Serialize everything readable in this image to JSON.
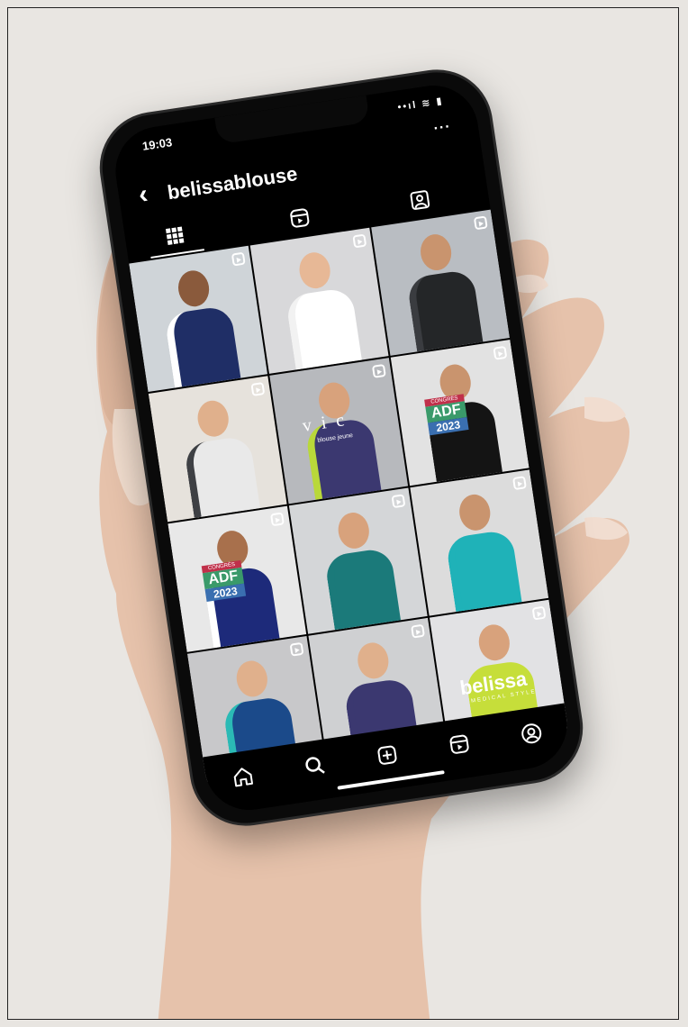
{
  "status": {
    "time": "19:03",
    "signal": "••ıl ≋ ▮"
  },
  "profile": {
    "username": "belissablouse",
    "more": "···"
  },
  "tabs": [
    {
      "name": "grid",
      "icon": "grid-icon",
      "active": true
    },
    {
      "name": "reels",
      "icon": "reels-icon",
      "active": false
    },
    {
      "name": "tagged",
      "icon": "tagged-icon",
      "active": false
    }
  ],
  "posts": [
    {
      "bg": "#cfd4d8",
      "shirt": "#1f2e66",
      "accent": "#ffffff",
      "skin": "#8a5a3c",
      "reel": true
    },
    {
      "bg": "#d8d8da",
      "shirt": "#ffffff",
      "accent": "#f2f2f2",
      "skin": "#e7b896",
      "reel": true
    },
    {
      "bg": "#b9bdc2",
      "shirt": "#242628",
      "accent": "#3a3c40",
      "skin": "#c9946e",
      "reel": true
    },
    {
      "bg": "#e6e2dc",
      "shirt": "#e9e9e9",
      "accent": "#3e4044",
      "skin": "#e0b08c",
      "reel": true
    },
    {
      "bg": "#b7b9bd",
      "shirt": "#3b3870",
      "accent": "#b9d83a",
      "skin": "#d8a27c",
      "reel": true,
      "caption": "v i c",
      "caption_sub": "blouse jeune"
    },
    {
      "bg": "#e2e2e2",
      "shirt": "#141414",
      "accent": "#141414",
      "skin": "#c9946e",
      "reel": true,
      "badge": {
        "l1": "CONGRÈS",
        "l2": "ADF",
        "l3": "2023"
      }
    },
    {
      "bg": "#e8e8e8",
      "shirt": "#1d2a7a",
      "accent": "#ffffff",
      "skin": "#a8704c",
      "reel": true,
      "badge": {
        "l1": "CONGRÈS",
        "l2": "ADF",
        "l3": "2023"
      }
    },
    {
      "bg": "#d4d6d8",
      "shirt": "#1b7a7a",
      "accent": "#1b7a7a",
      "skin": "#d8a27c",
      "reel": true
    },
    {
      "bg": "#dcdcdc",
      "shirt": "#1fb2b8",
      "accent": "#1fb2b8",
      "skin": "#c9946e",
      "reel": true
    },
    {
      "bg": "#c8c8ca",
      "shirt": "#1b4a8a",
      "accent": "#2bbab5",
      "skin": "#e0b08c",
      "reel": true
    },
    {
      "bg": "#cfd0d2",
      "shirt": "#3b3870",
      "accent": "#3b3870",
      "skin": "#e0b08c",
      "reel": true
    },
    {
      "bg": "#e2e2e4",
      "shirt": "#c6de3a",
      "accent": "#c6de3a",
      "skin": "#d8a27c",
      "reel": true,
      "brand": "belissa",
      "brand_sub": "MEDICAL STYLE"
    }
  ],
  "bottom_nav": [
    "home-icon",
    "search-icon",
    "add-post-icon",
    "reels-icon",
    "profile-icon"
  ]
}
